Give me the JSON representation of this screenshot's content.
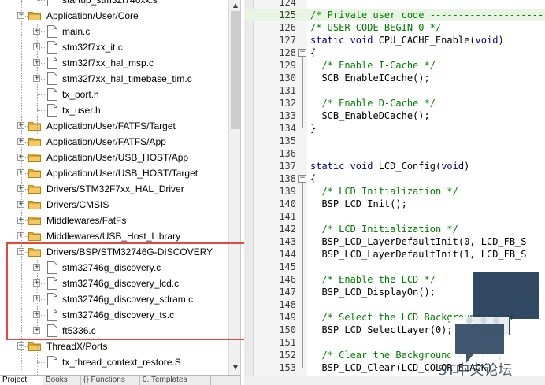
{
  "tree": {
    "items": [
      {
        "label": "startup_stm32f746xx.s",
        "kind": "file",
        "level": 2
      },
      {
        "label": "Application/User/Core",
        "kind": "folder",
        "level": 1,
        "expanded": true
      },
      {
        "label": "main.c",
        "kind": "file",
        "level": 2,
        "expander": true
      },
      {
        "label": "stm32f7xx_it.c",
        "kind": "file",
        "level": 2,
        "expander": true
      },
      {
        "label": "stm32f7xx_hal_msp.c",
        "kind": "file",
        "level": 2,
        "expander": true
      },
      {
        "label": "stm32f7xx_hal_timebase_tim.c",
        "kind": "file",
        "level": 2,
        "expander": true
      },
      {
        "label": "tx_port.h",
        "kind": "file",
        "level": 2,
        "expander": false
      },
      {
        "label": "tx_user.h",
        "kind": "file",
        "level": 2,
        "expander": false
      },
      {
        "label": "Application/User/FATFS/Target",
        "kind": "folder",
        "level": 1,
        "expanded": false
      },
      {
        "label": "Application/User/FATFS/App",
        "kind": "folder",
        "level": 1,
        "expanded": false
      },
      {
        "label": "Application/User/USB_HOST/App",
        "kind": "folder",
        "level": 1,
        "expanded": false
      },
      {
        "label": "Application/User/USB_HOST/Target",
        "kind": "folder",
        "level": 1,
        "expanded": false
      },
      {
        "label": "Drivers/STM32F7xx_HAL_Driver",
        "kind": "folder",
        "level": 1,
        "expanded": false
      },
      {
        "label": "Drivers/CMSIS",
        "kind": "folder",
        "level": 1,
        "expanded": false
      },
      {
        "label": "Middlewares/FatFs",
        "kind": "folder",
        "level": 1,
        "expanded": false
      },
      {
        "label": "Middlewares/USB_Host_Library",
        "kind": "folder",
        "level": 1,
        "expanded": false
      },
      {
        "label": "Drivers/BSP/STM32746G-DISCOVERY",
        "kind": "folder",
        "level": 1,
        "expanded": true
      },
      {
        "label": "stm32746g_discovery.c",
        "kind": "file",
        "level": 2,
        "expander": true
      },
      {
        "label": "stm32746g_discovery_lcd.c",
        "kind": "file",
        "level": 2,
        "expander": true
      },
      {
        "label": "stm32746g_discovery_sdram.c",
        "kind": "file",
        "level": 2,
        "expander": true
      },
      {
        "label": "stm32746g_discovery_ts.c",
        "kind": "file",
        "level": 2,
        "expander": true
      },
      {
        "label": "ft5336.c",
        "kind": "file",
        "level": 2,
        "expander": true
      },
      {
        "label": "ThreadX/Ports",
        "kind": "folder",
        "level": 1,
        "expanded": true
      },
      {
        "label": "tx_thread_context_restore.S",
        "kind": "file",
        "level": 2,
        "expander": false
      }
    ]
  },
  "bottom_tabs": [
    {
      "label": "Project",
      "icon": "project-icon",
      "active": true
    },
    {
      "label": "Books",
      "icon": "books-icon",
      "active": false
    },
    {
      "label": "{} Functions",
      "icon": "functions-icon",
      "active": false
    },
    {
      "label": "0. Templates",
      "icon": "templates-icon",
      "active": false
    }
  ],
  "code": {
    "lines": [
      {
        "num": "124",
        "text": "",
        "type": "plain"
      },
      {
        "num": "125",
        "text": "/* Private user code -----------------------",
        "type": "comment",
        "current": true
      },
      {
        "num": "126",
        "text": "/* USER CODE BEGIN 0 */",
        "type": "comment"
      },
      {
        "num": "127",
        "text": "static void CPU_CACHE_Enable(void)",
        "type": "decl"
      },
      {
        "num": "128",
        "text": "{",
        "type": "plain",
        "fold": "open"
      },
      {
        "num": "129",
        "text": "  /* Enable I-Cache */",
        "type": "comment"
      },
      {
        "num": "130",
        "text": "  SCB_EnableICache();",
        "type": "plain"
      },
      {
        "num": "131",
        "text": "",
        "type": "plain"
      },
      {
        "num": "132",
        "text": "  /* Enable D-Cache */",
        "type": "comment"
      },
      {
        "num": "133",
        "text": "  SCB_EnableDCache();",
        "type": "plain"
      },
      {
        "num": "134",
        "text": "}",
        "type": "plain",
        "fold": "end"
      },
      {
        "num": "135",
        "text": "",
        "type": "plain"
      },
      {
        "num": "136",
        "text": "",
        "type": "plain"
      },
      {
        "num": "137",
        "text": "static void LCD_Config(void)",
        "type": "decl"
      },
      {
        "num": "138",
        "text": "{",
        "type": "plain",
        "fold": "open"
      },
      {
        "num": "139",
        "text": "  /* LCD Initialization */",
        "type": "comment"
      },
      {
        "num": "140",
        "text": "  BSP_LCD_Init();",
        "type": "plain"
      },
      {
        "num": "141",
        "text": "",
        "type": "plain"
      },
      {
        "num": "142",
        "text": "  /* LCD Initialization */",
        "type": "comment"
      },
      {
        "num": "143",
        "text": "  BSP_LCD_LayerDefaultInit(0, LCD_FB_S",
        "type": "plain"
      },
      {
        "num": "144",
        "text": "  BSP_LCD_LayerDefaultInit(1, LCD_FB_S",
        "type": "plain"
      },
      {
        "num": "145",
        "text": "",
        "type": "plain"
      },
      {
        "num": "146",
        "text": "  /* Enable the LCD */",
        "type": "comment"
      },
      {
        "num": "147",
        "text": "  BSP_LCD_DisplayOn();",
        "type": "plain"
      },
      {
        "num": "148",
        "text": "",
        "type": "plain"
      },
      {
        "num": "149",
        "text": "  /* Select the LCD Background Layer",
        "type": "comment"
      },
      {
        "num": "150",
        "text": "  BSP_LCD_SelectLayer(0);",
        "type": "plain"
      },
      {
        "num": "151",
        "text": "",
        "type": "plain"
      },
      {
        "num": "152",
        "text": "  /* Clear the Background Layer */",
        "type": "comment"
      },
      {
        "num": "153",
        "text": "  BSP_LCD_Clear(LCD_COLOR_BLACK);",
        "type": "plain"
      }
    ]
  },
  "watermark": {
    "text": "ST中文论坛",
    "color": "#233a52"
  },
  "colors": {
    "highlight": "#e8453c",
    "comment": "#008000",
    "keyword": "#00008b",
    "current_line": "#e8f5e3"
  }
}
